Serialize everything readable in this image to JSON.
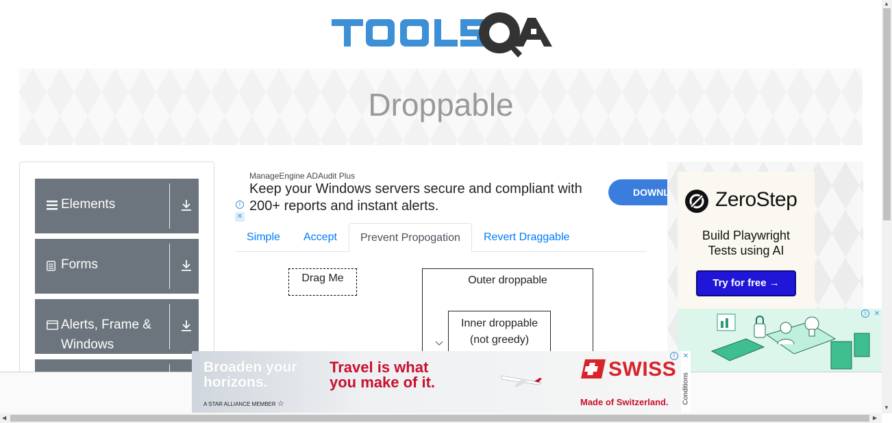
{
  "logo": {
    "text": "TOOLSQA"
  },
  "banner": {
    "title": "Droppable"
  },
  "sidebar": {
    "groups": [
      {
        "label": "Elements",
        "icon": "list-icon"
      },
      {
        "label": "Forms",
        "icon": "document-icon"
      },
      {
        "label": "Alerts, Frame &",
        "label2": "Windows",
        "icon": "window-icon"
      }
    ]
  },
  "ad_top": {
    "brand": "ManageEngine ADAudit Plus",
    "headline": "Keep your Windows servers secure and compliant with 200+ reports and instant alerts.",
    "cta": "DOWNLOAD"
  },
  "tabs": [
    {
      "label": "Simple",
      "active": false
    },
    {
      "label": "Accept",
      "active": false
    },
    {
      "label": "Prevent Propogation",
      "active": true
    },
    {
      "label": "Revert Draggable",
      "active": false
    }
  ],
  "drag": {
    "drag_me": "Drag Me",
    "outer": "Outer droppable",
    "inner_line1": "Inner droppable",
    "inner_line2": "(not greedy)"
  },
  "ad_right": {
    "brand": "ZeroStep",
    "tag_line1": "Build Playwright",
    "tag_line2": "Tests using AI",
    "cta": "Try for free →"
  },
  "ad_bottom": {
    "left_line1": "Broaden your",
    "left_line2": "horizons.",
    "alliance": "A STAR ALLIANCE MEMBER",
    "mid_line1": "Travel is what",
    "mid_line2": "you make of it.",
    "brand": "SWISS",
    "tagline": "Made of Switzerland.",
    "conditions": "Conditions"
  },
  "colors": {
    "accent": "#007bff",
    "menu_bg": "#6c757d",
    "swiss_red": "#d8232a",
    "zerostep_btn": "#1f16d7"
  }
}
